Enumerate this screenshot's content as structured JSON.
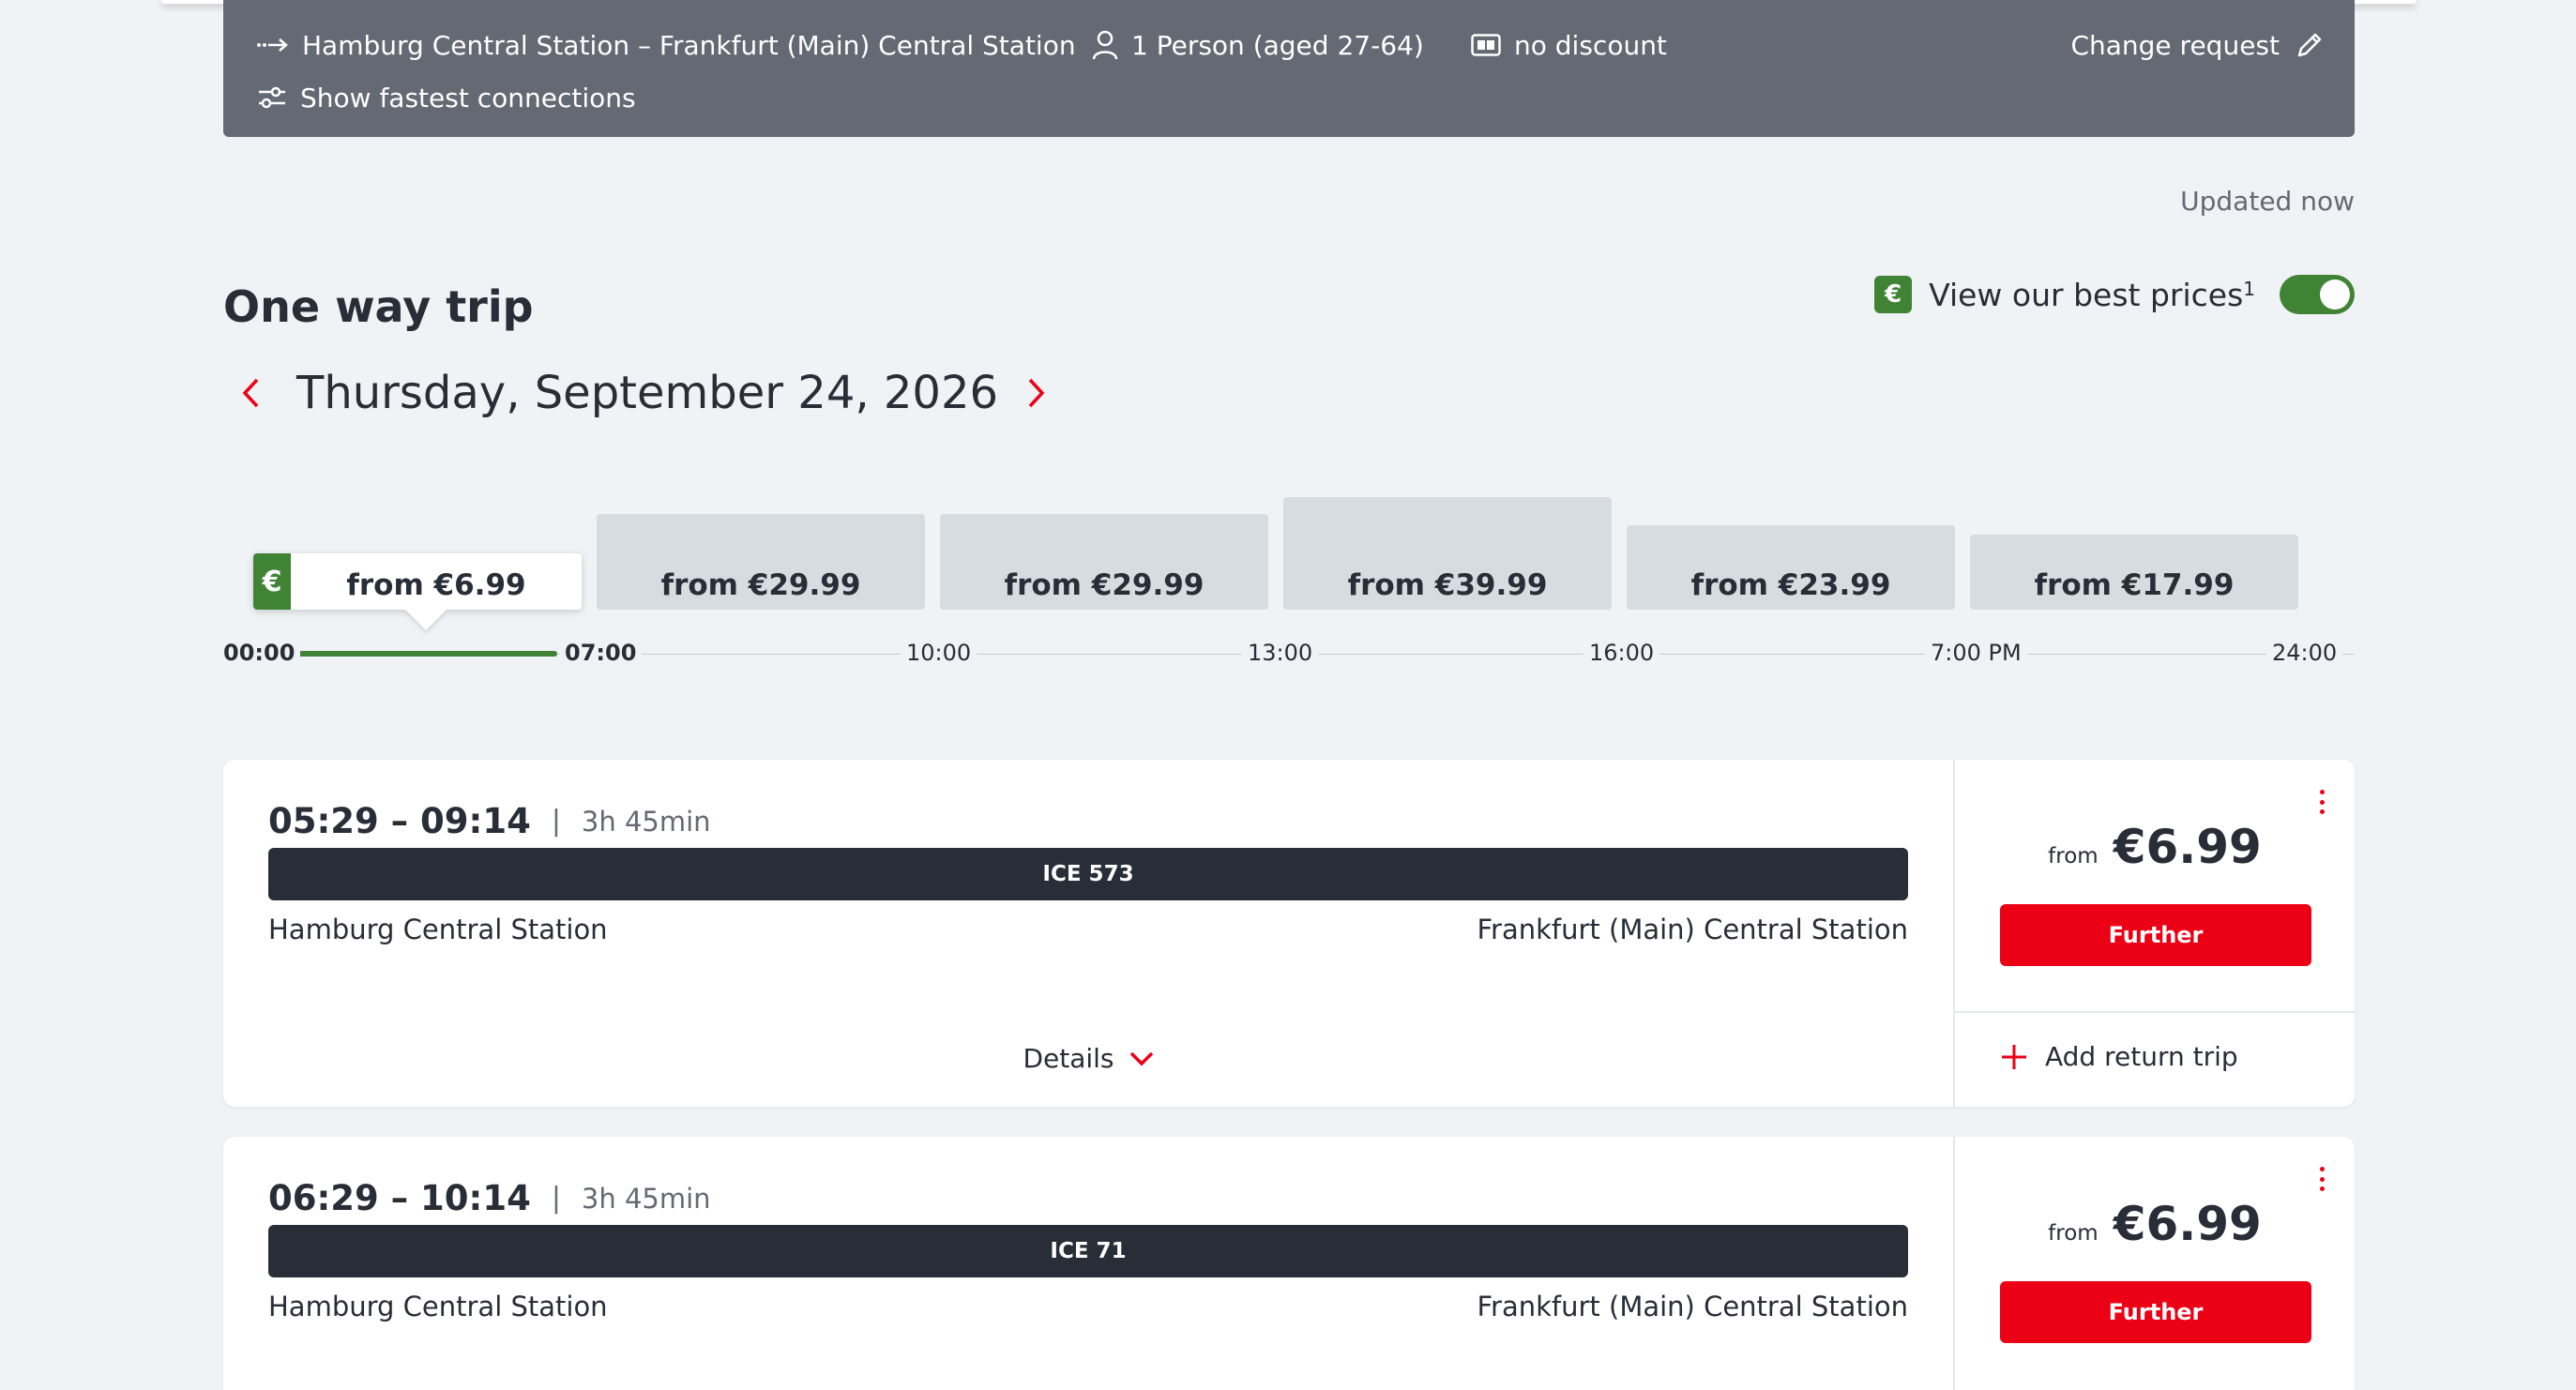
{
  "search_summary": {
    "route": "Hamburg Central Station – Frankfurt (Main) Central Station",
    "passengers": "1 Person (aged 27-64)",
    "discount": "no discount",
    "change_request": "Change request",
    "fastest": "Show fastest connections"
  },
  "status": {
    "updated": "Updated now"
  },
  "trip": {
    "title": "One way trip",
    "best_prices_label": "View our best prices",
    "best_prices_footnote": "1",
    "best_prices_enabled": true,
    "date": "Thursday, September 24, 2026",
    "euro_symbol": "€"
  },
  "timeline": {
    "slots": [
      {
        "label": "from €6.99",
        "active": true
      },
      {
        "label": "from €29.99",
        "active": false
      },
      {
        "label": "from €29.99",
        "active": false
      },
      {
        "label": "from €39.99",
        "active": false
      },
      {
        "label": "from €23.99",
        "active": false
      },
      {
        "label": "from €17.99",
        "active": false
      }
    ],
    "ticks": [
      "00:00",
      "07:00",
      "10:00",
      "13:00",
      "16:00",
      "7:00 PM",
      "24:00"
    ]
  },
  "connections": [
    {
      "departure": "05:29",
      "arrival": "09:14",
      "times": "05:29 – 09:14",
      "separator": "|",
      "duration": "3h 45min",
      "train": "ICE 573",
      "from_station": "Hamburg Central Station",
      "to_station": "Frankfurt (Main) Central Station",
      "details": "Details",
      "price_prefix": "from",
      "price": "€6.99",
      "button": "Further",
      "return_trip": "Add return trip"
    },
    {
      "departure": "06:29",
      "arrival": "10:14",
      "times": "06:29 – 10:14",
      "separator": "|",
      "duration": "3h 45min",
      "train": "ICE 71",
      "from_station": "Hamburg Central Station",
      "to_station": "Frankfurt (Main) Central Station",
      "price_prefix": "from",
      "price": "€6.99",
      "button": "Further"
    }
  ],
  "colors": {
    "accent_red": "#ec0016",
    "best_price_green": "#408335",
    "summary_bg": "#646973",
    "train_bar": "#282d37"
  }
}
